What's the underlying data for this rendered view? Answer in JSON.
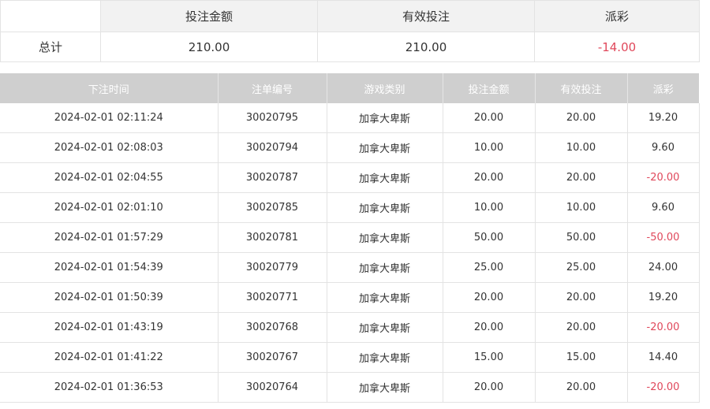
{
  "summary": {
    "headers": [
      "",
      "投注金额",
      "有效投注",
      "派彩"
    ],
    "row": {
      "label": "总计",
      "amount": "210.00",
      "valid": "210.00",
      "payout": "-14.00"
    }
  },
  "detail": {
    "headers": [
      "下注时间",
      "注单编号",
      "游戏类别",
      "投注金额",
      "有效投注",
      "派彩"
    ],
    "rows": [
      {
        "time": "2024-02-01 02:11:24",
        "id": "30020795",
        "game": "加拿大卑斯",
        "amount": "20.00",
        "valid": "20.00",
        "payout": "19.20",
        "negative": false
      },
      {
        "time": "2024-02-01 02:08:03",
        "id": "30020794",
        "game": "加拿大卑斯",
        "amount": "10.00",
        "valid": "10.00",
        "payout": "9.60",
        "negative": false
      },
      {
        "time": "2024-02-01 02:04:55",
        "id": "30020787",
        "game": "加拿大卑斯",
        "amount": "20.00",
        "valid": "20.00",
        "payout": "-20.00",
        "negative": true
      },
      {
        "time": "2024-02-01 02:01:10",
        "id": "30020785",
        "game": "加拿大卑斯",
        "amount": "10.00",
        "valid": "10.00",
        "payout": "9.60",
        "negative": false
      },
      {
        "time": "2024-02-01 01:57:29",
        "id": "30020781",
        "game": "加拿大卑斯",
        "amount": "50.00",
        "valid": "50.00",
        "payout": "-50.00",
        "negative": true
      },
      {
        "time": "2024-02-01 01:54:39",
        "id": "30020779",
        "game": "加拿大卑斯",
        "amount": "25.00",
        "valid": "25.00",
        "payout": "24.00",
        "negative": false
      },
      {
        "time": "2024-02-01 01:50:39",
        "id": "30020771",
        "game": "加拿大卑斯",
        "amount": "20.00",
        "valid": "20.00",
        "payout": "19.20",
        "negative": false
      },
      {
        "time": "2024-02-01 01:43:19",
        "id": "30020768",
        "game": "加拿大卑斯",
        "amount": "20.00",
        "valid": "20.00",
        "payout": "-20.00",
        "negative": true
      },
      {
        "time": "2024-02-01 01:41:22",
        "id": "30020767",
        "game": "加拿大卑斯",
        "amount": "15.00",
        "valid": "15.00",
        "payout": "14.40",
        "negative": false
      },
      {
        "time": "2024-02-01 01:36:53",
        "id": "30020764",
        "game": "加拿大卑斯",
        "amount": "20.00",
        "valid": "20.00",
        "payout": "-20.00",
        "negative": true
      }
    ]
  },
  "colors": {
    "negative": "#e0485b",
    "header_bg": "#cfcfcf",
    "summary_header_bg": "#f2f2f2"
  }
}
